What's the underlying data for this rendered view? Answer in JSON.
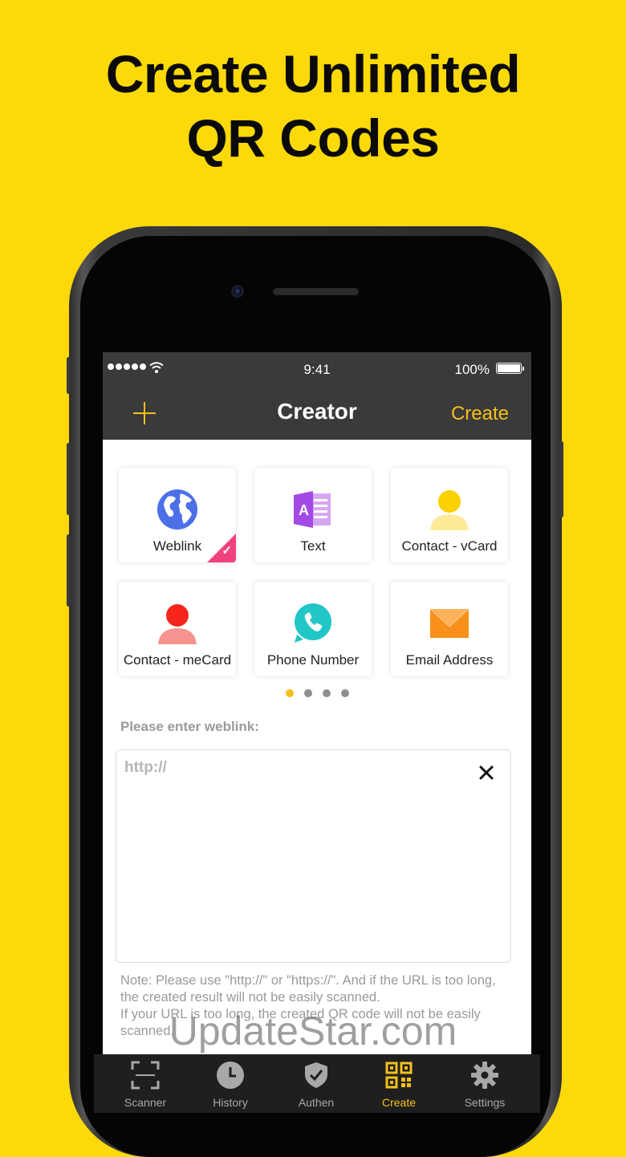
{
  "headline": {
    "line1": "Create Unlimited",
    "line2": "QR Codes"
  },
  "status_bar": {
    "time": "9:41",
    "battery": "100%"
  },
  "nav": {
    "title": "Creator",
    "action": "Create"
  },
  "types": [
    {
      "label": "Weblink",
      "icon": "globe-icon",
      "selected": true
    },
    {
      "label": "Text",
      "icon": "text-document-icon",
      "selected": false
    },
    {
      "label": "Contact - vCard",
      "icon": "person-yellow-icon",
      "selected": false
    },
    {
      "label": "Contact - meCard",
      "icon": "person-red-icon",
      "selected": false
    },
    {
      "label": "Phone Number",
      "icon": "phone-icon",
      "selected": false
    },
    {
      "label": "Email Address",
      "icon": "envelope-icon",
      "selected": false
    }
  ],
  "pager": {
    "pages": 4,
    "current": 1
  },
  "form": {
    "prompt": "Please enter weblink:",
    "placeholder": "http://",
    "value": "",
    "note": "Note: Please use \"http://\" or \"https://\". And if the URL is too long, the created result will not be easily scanned.\nIf your URL is too long, the created QR code will not be easily scanned."
  },
  "tabs": [
    {
      "label": "Scanner",
      "icon": "scan-frame-icon",
      "active": false
    },
    {
      "label": "History",
      "icon": "clock-icon",
      "active": false
    },
    {
      "label": "Authen",
      "icon": "shield-check-icon",
      "active": false
    },
    {
      "label": "Create",
      "icon": "qr-code-icon",
      "active": true
    },
    {
      "label": "Settings",
      "icon": "gear-icon",
      "active": false
    }
  ],
  "watermark": "UpdateStar.com",
  "colors": {
    "background": "#FCD908",
    "accent": "#F6C01A",
    "nav": "#3A3A3A",
    "tabbar": "#1F1F1F",
    "selected_badge": "#F2427E"
  }
}
